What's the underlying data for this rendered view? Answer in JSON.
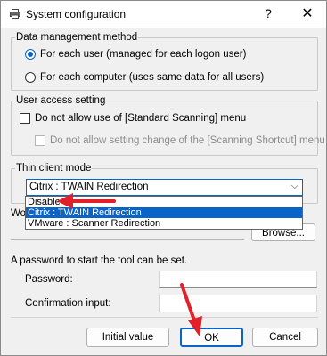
{
  "window": {
    "title": "System configuration",
    "help_glyph": "?",
    "close_glyph": "✕"
  },
  "data_management": {
    "label": "Data management method",
    "options": [
      {
        "label": "For each user (managed for each logon user)",
        "selected": true
      },
      {
        "label": "For each computer (uses same data for all users)",
        "selected": false
      }
    ]
  },
  "user_access": {
    "label": "User access setting",
    "options": [
      {
        "label": "Do not allow use of [Standard Scanning] menu",
        "checked": false,
        "enabled": true
      },
      {
        "label": "Do not allow setting change of the [Scanning Shortcut] menu",
        "checked": false,
        "enabled": false
      }
    ]
  },
  "thin_client": {
    "label": "Thin client mode",
    "selected_value": "Citrix : TWAIN Redirection",
    "arrow_icon": "chevron-down-icon",
    "dropdown_items": [
      {
        "label": "Disable",
        "highlighted": false
      },
      {
        "label": "Citrix : TWAIN Redirection",
        "highlighted": true
      },
      {
        "label": "VMware : Scanner Redirection",
        "highlighted": false
      }
    ]
  },
  "work_folder": {
    "label_partial": "Wo",
    "browse_label": "Browse..."
  },
  "password": {
    "info": "A password to start the tool can be set.",
    "password_label": "Password:",
    "confirmation_label": "Confirmation input:"
  },
  "buttons": {
    "initial_value": "Initial value",
    "ok": "OK",
    "cancel": "Cancel"
  },
  "colors": {
    "accent": "#0a64c8",
    "annotation_arrow": "#e0202a"
  }
}
